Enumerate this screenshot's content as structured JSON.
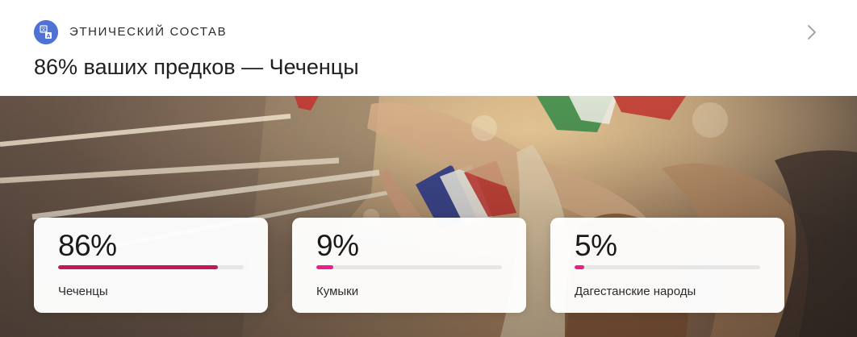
{
  "header": {
    "section_label": "ЭТНИЧЕСКИЙ СОСТАВ",
    "section_icon": "translate-icon",
    "headline": "86% ваших предков — Чеченцы",
    "chevron_icon": "chevron-right-icon"
  },
  "colors": {
    "icon_bg": "#4f72d6",
    "bar_primary": "#c2185b",
    "bar_accent": "#e91e8c",
    "track": "#e6e6e6"
  },
  "stats": [
    {
      "value": "86%",
      "label": "Чеченцы",
      "fraction": 0.86,
      "color": "#c2185b"
    },
    {
      "value": "9%",
      "label": "Кумыки",
      "fraction": 0.09,
      "color": "#e91e8c"
    },
    {
      "value": "5%",
      "label": "Дагестанские народы",
      "fraction": 0.05,
      "color": "#e91e8c"
    }
  ]
}
